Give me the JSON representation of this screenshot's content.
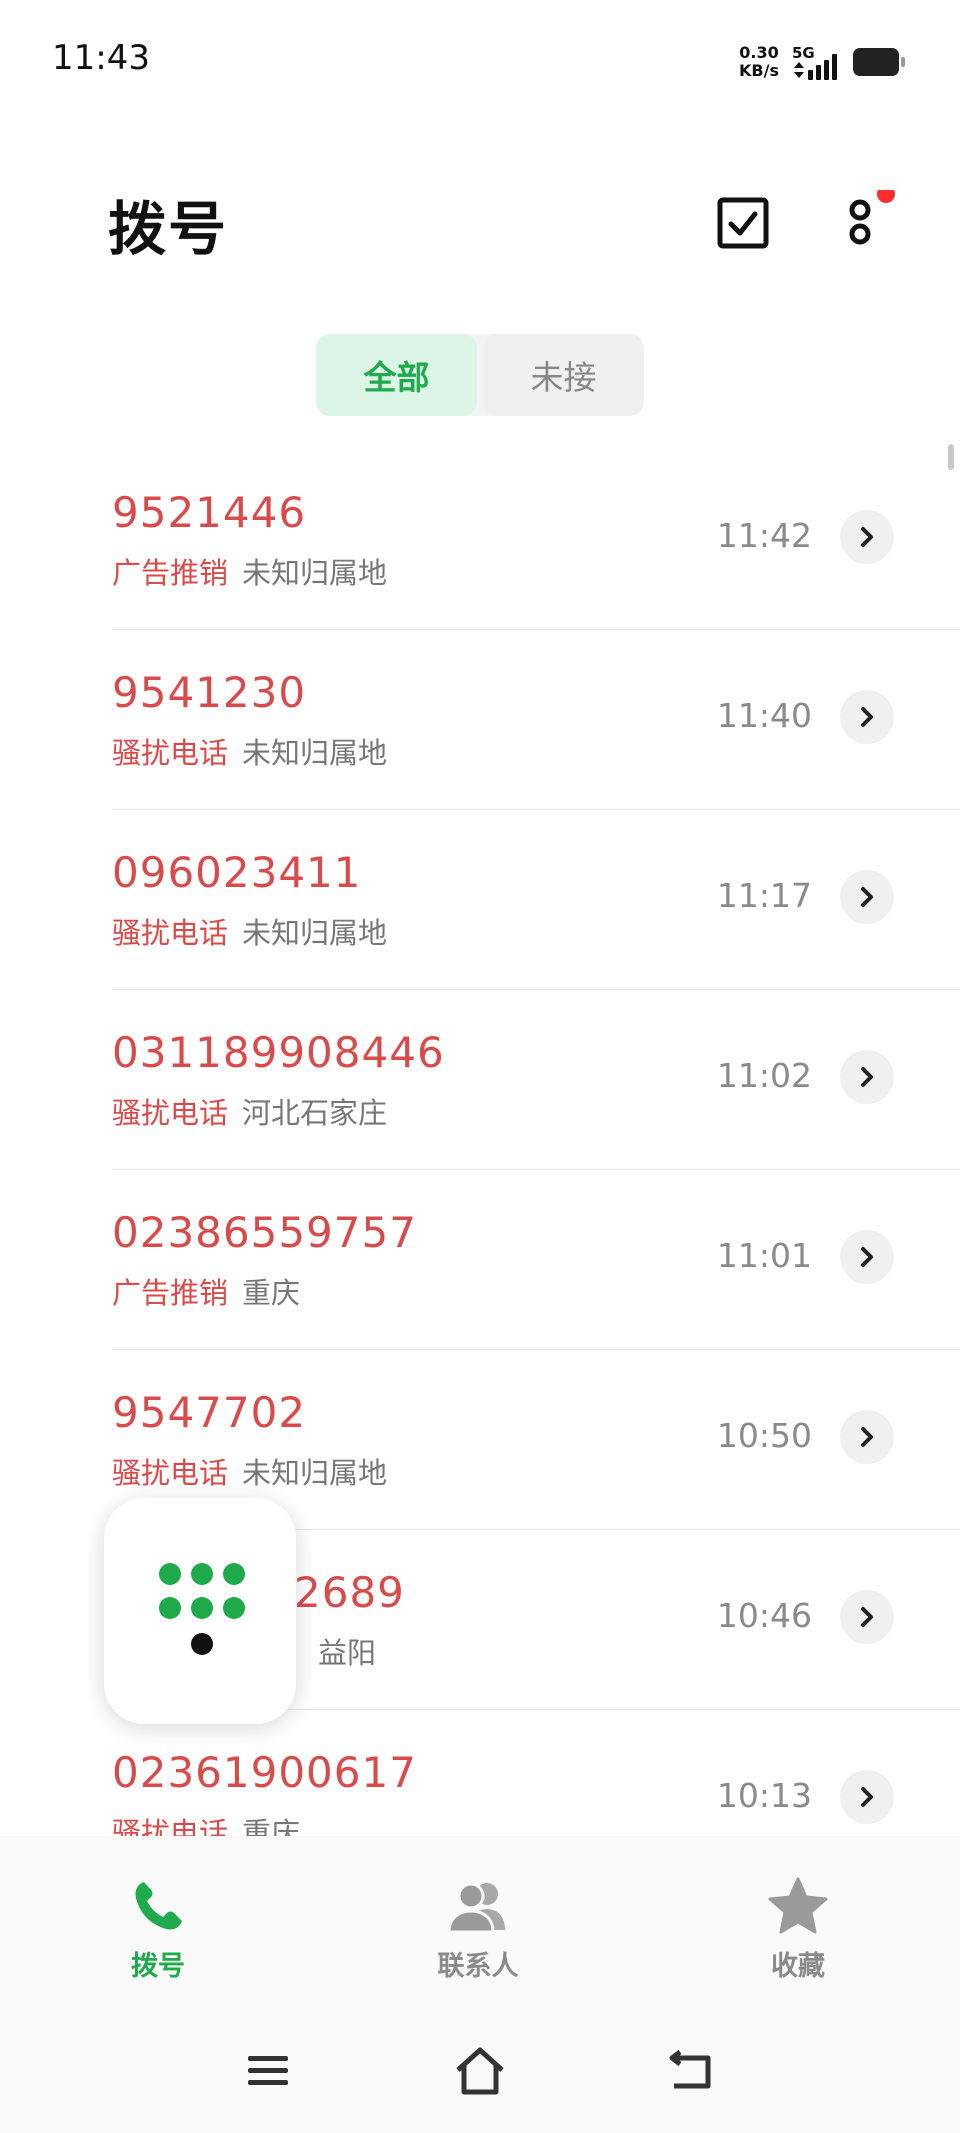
{
  "status_bar": {
    "time": "11:43",
    "net_speed_value": "0.30",
    "net_speed_unit": "KB/s",
    "network_type": "5G",
    "signal_icon": "signal-bars-icon",
    "battery_icon": "battery-icon"
  },
  "header": {
    "title": "拨号",
    "edit_icon": "checkbox-edit-icon",
    "more_icon": "more-dots-icon",
    "notification_color": "#ff2d2d"
  },
  "filter_tabs": [
    {
      "label": "全部",
      "active": true
    },
    {
      "label": "未接",
      "active": false
    }
  ],
  "calls": [
    {
      "number": "9521446",
      "tag": "广告推销",
      "location": "未知归属地",
      "time": "11:42"
    },
    {
      "number": "9541230",
      "tag": "骚扰电话",
      "location": "未知归属地",
      "time": "11:40"
    },
    {
      "number": "096023411",
      "tag": "骚扰电话",
      "location": "未知归属地",
      "time": "11:17"
    },
    {
      "number": "031189908446",
      "tag": "骚扰电话",
      "location": "河北石家庄",
      "time": "11:02"
    },
    {
      "number": "02386559757",
      "tag": "广告推销",
      "location": "重庆",
      "time": "11:01"
    },
    {
      "number": "9547702",
      "tag": "骚扰电话",
      "location": "未知归属地",
      "time": "10:50"
    },
    {
      "number": "2689",
      "tag": "",
      "location": "益阳",
      "time": "10:46"
    },
    {
      "number": "02361900617",
      "tag": "骚扰电话",
      "location": "重庆",
      "time": "10:13"
    }
  ],
  "dialpad_button": {
    "icon": "dialpad-icon"
  },
  "bottom_nav": [
    {
      "label": "拨号",
      "icon": "phone-icon",
      "active": true
    },
    {
      "label": "联系人",
      "icon": "contacts-icon",
      "active": false
    },
    {
      "label": "收藏",
      "icon": "star-icon",
      "active": false
    }
  ],
  "system_nav": {
    "menu_icon": "menu-icon",
    "home_icon": "home-icon",
    "back_icon": "back-icon"
  },
  "colors": {
    "accent": "#1faa4b",
    "spam_red": "#d94b4b",
    "muted": "#8a8a8a"
  }
}
